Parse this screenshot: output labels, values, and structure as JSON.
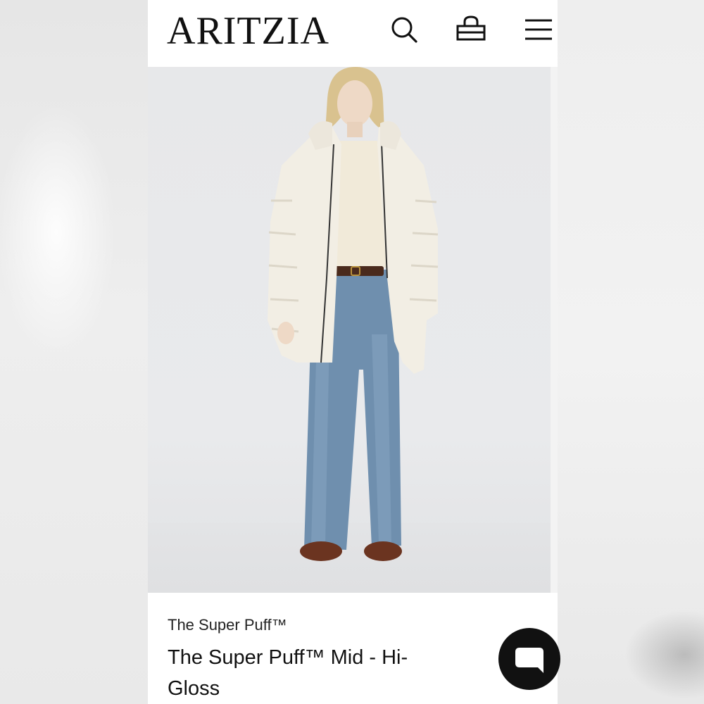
{
  "header": {
    "logo": "ARITZIA",
    "search_icon": "search-icon",
    "bag_icon": "shopping-bag-icon",
    "menu_icon": "hamburger-menu-icon"
  },
  "product": {
    "image_alt": "Model wearing a cream puffer coat and wide-leg jeans",
    "collection": "The Super Puff™",
    "title": "The Super Puff™ Mid - Hi-Gloss"
  },
  "chat": {
    "icon": "chat-bubble-icon"
  },
  "colors": {
    "text": "#111111",
    "background": "#ffffff",
    "chat_button": "#111111"
  }
}
